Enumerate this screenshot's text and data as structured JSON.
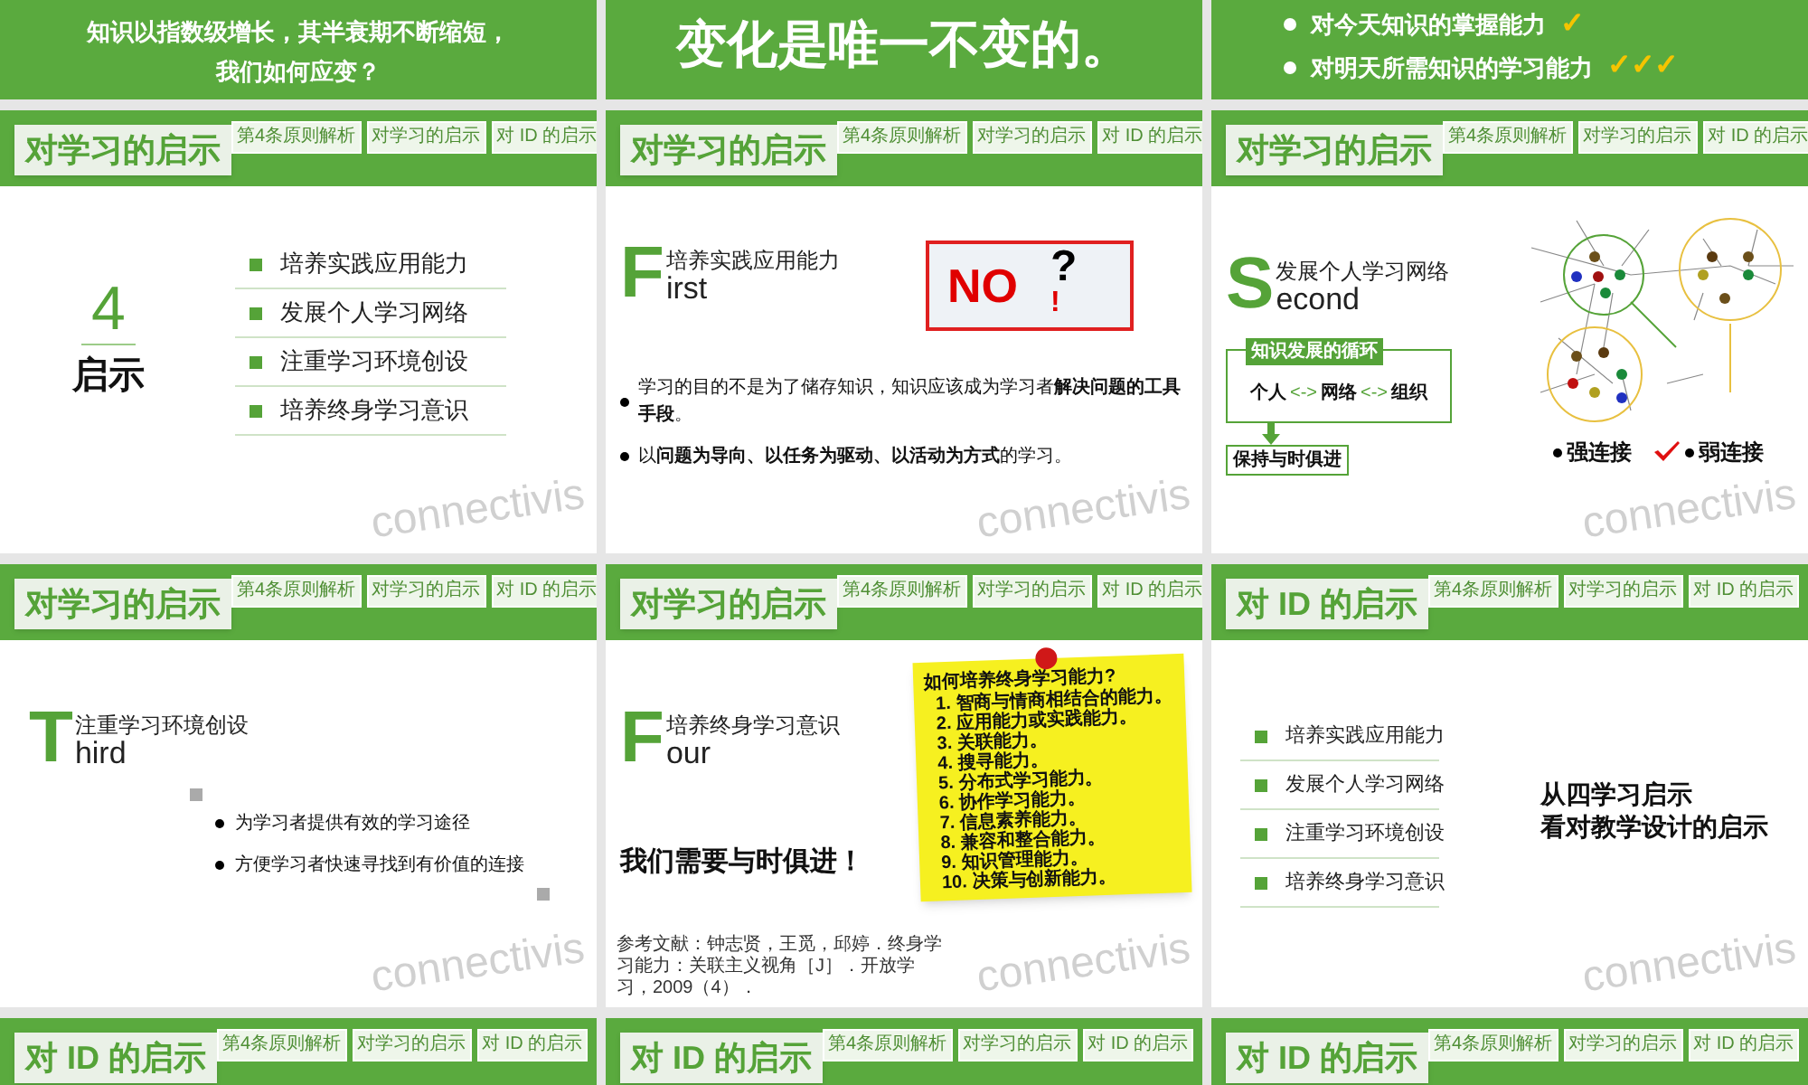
{
  "slides": [
    {
      "kind": "statement",
      "lines": [
        "知识以指数级增长，其半衰期不断缩短，",
        "我们如何应变？"
      ]
    },
    {
      "kind": "headline",
      "text": "变化是唯一不变的。"
    },
    {
      "kind": "checklist",
      "items": [
        {
          "text": "对今天知识的掌握能力",
          "ticks": "✓"
        },
        {
          "text": "对明天所需知识的学习能力",
          "ticks": "✓✓✓"
        }
      ]
    },
    {
      "kind": "overview",
      "title": "对学习的启示",
      "tabs": [
        "第4条原则解析",
        "对学习的启示",
        "对 ID 的启示"
      ],
      "number": "4",
      "label": "启示",
      "items": [
        "培养实践应用能力",
        "发展个人学习网络",
        "注重学习环境创设",
        "培养终身学习意识"
      ],
      "watermark": "connectivis"
    },
    {
      "kind": "first",
      "title": "对学习的启示",
      "tabs": [
        "第4条原则解析",
        "对学习的启示",
        "对 ID 的启示"
      ],
      "letter": "F",
      "rest": "irst",
      "heading": "培养实践应用能力",
      "sign": {
        "text": "NO",
        "question": "?",
        "exclaim": "!"
      },
      "bullets": [
        "学习的目的不是为了储存知识，知识应该成为学习者**解决问题的工具手段**。",
        "以**问题为导向、以任务为驱动、以活动为方式**的学习。"
      ],
      "watermark": "connectivis"
    },
    {
      "kind": "second",
      "title": "对学习的启示",
      "tabs": [
        "第4条原则解析",
        "对学习的启示",
        "对 ID 的启示"
      ],
      "letter": "S",
      "rest": "econd",
      "heading": "发展个人学习网络",
      "cycle": {
        "label": "知识发展的循环",
        "nodes": [
          "个人",
          "网络",
          "组织"
        ],
        "arrow": "<->",
        "result": "保持与时俱进"
      },
      "links": [
        "强连接",
        "弱连接"
      ],
      "watermark": "connectivis"
    },
    {
      "kind": "third",
      "title": "对学习的启示",
      "tabs": [
        "第4条原则解析",
        "对学习的启示",
        "对 ID 的启示"
      ],
      "letter": "T",
      "rest": "hird",
      "heading": "注重学习环境创设",
      "bullets": [
        "为学习者提供有效的学习途径",
        "方便学习者快速寻找到有价值的连接"
      ],
      "watermark": "connectivis"
    },
    {
      "kind": "four",
      "title": "对学习的启示",
      "tabs": [
        "第4条原则解析",
        "对学习的启示",
        "对 ID 的启示"
      ],
      "letter": "F",
      "rest": "our",
      "heading": "培养终身学习意识",
      "slogan": "我们需要**与时俱进**！",
      "note": {
        "title": "如何培养终身学习能力?",
        "items": [
          "1. 智商与情商相结合的能力。",
          "2. 应用能力或实践能力。",
          "3. 关联能力。",
          "4. 搜寻能力。",
          "5. 分布式学习能力。",
          "6. 协作学习能力。",
          "7. 信息素养能力。",
          "8. 兼容和整合能力。",
          "9. 知识管理能力。",
          "10. 决策与创新能力。"
        ]
      },
      "reference": "参考文献：钟志贤，王觅，邱婷．终身学习能力：关联主义视角［J］．开放学习，2009（4）．",
      "watermark": "connectivis"
    },
    {
      "kind": "summary",
      "title": "对 ID 的启示",
      "tabs": [
        "第4条原则解析",
        "对学习的启示",
        "对 ID 的启示"
      ],
      "items": [
        "培养实践应用能力",
        "发展个人学习网络",
        "注重学习环境创设",
        "培养终身学习意识"
      ],
      "lines": [
        "从**四**学习启示",
        "看**对教学设计的启示**"
      ],
      "watermark": "connectivis"
    },
    {
      "kind": "header",
      "title": "对 ID 的启示",
      "tabs": [
        "第4条原则解析",
        "对学习的启示",
        "对 ID 的启示"
      ]
    },
    {
      "kind": "header",
      "title": "对 ID 的启示",
      "tabs": [
        "第4条原则解析",
        "对学习的启示",
        "对 ID 的启示"
      ]
    },
    {
      "kind": "header",
      "title": "对 ID 的启示",
      "tabs": [
        "第4条原则解析",
        "对学习的启示",
        "对 ID 的启示"
      ]
    }
  ]
}
